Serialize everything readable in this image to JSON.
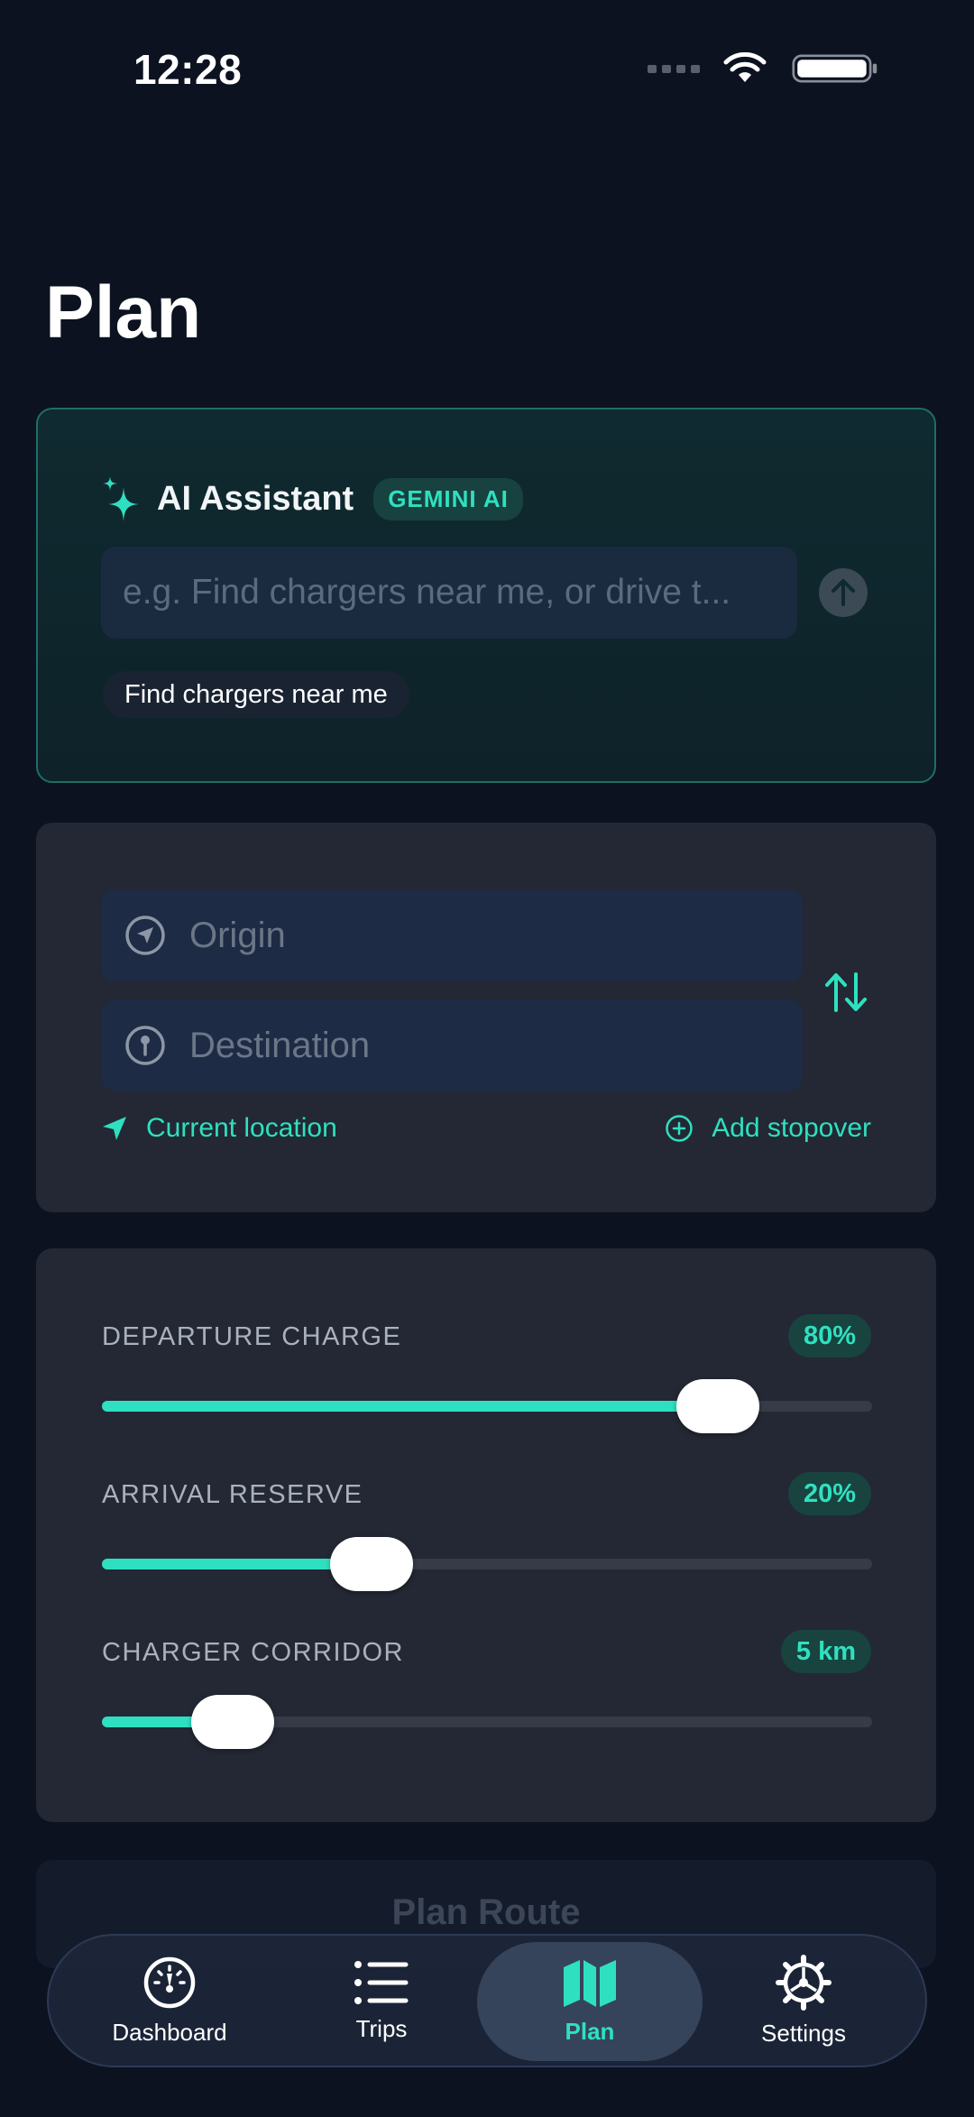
{
  "status_bar": {
    "time": "12:28"
  },
  "header": {
    "title": "Plan"
  },
  "ai_assistant": {
    "title": "AI Assistant",
    "badge": "GEMINI AI",
    "input_placeholder": "e.g. Find chargers near me, or drive t...",
    "input_value": "",
    "suggestion_chip": "Find chargers near me"
  },
  "route": {
    "origin_placeholder": "Origin",
    "destination_placeholder": "Destination",
    "current_location_label": "Current location",
    "add_stopover_label": "Add stopover"
  },
  "sliders": [
    {
      "label": "DEPARTURE CHARGE",
      "value": "80%",
      "fraction": 0.8
    },
    {
      "label": "ARRIVAL RESERVE",
      "value": "20%",
      "fraction": 0.35
    },
    {
      "label": "CHARGER CORRIDOR",
      "value": "5 km",
      "fraction": 0.17
    }
  ],
  "plan_button": {
    "label": "Plan Route"
  },
  "tabs": [
    {
      "label": "Dashboard",
      "icon": "gauge-icon",
      "active": false
    },
    {
      "label": "Trips",
      "icon": "list-icon",
      "active": false
    },
    {
      "label": "Plan",
      "icon": "map-icon",
      "active": true
    },
    {
      "label": "Settings",
      "icon": "gear-icon",
      "active": false
    }
  ],
  "colors": {
    "accent": "#2fe0c0",
    "background": "#0c1220",
    "card": "#232834"
  }
}
